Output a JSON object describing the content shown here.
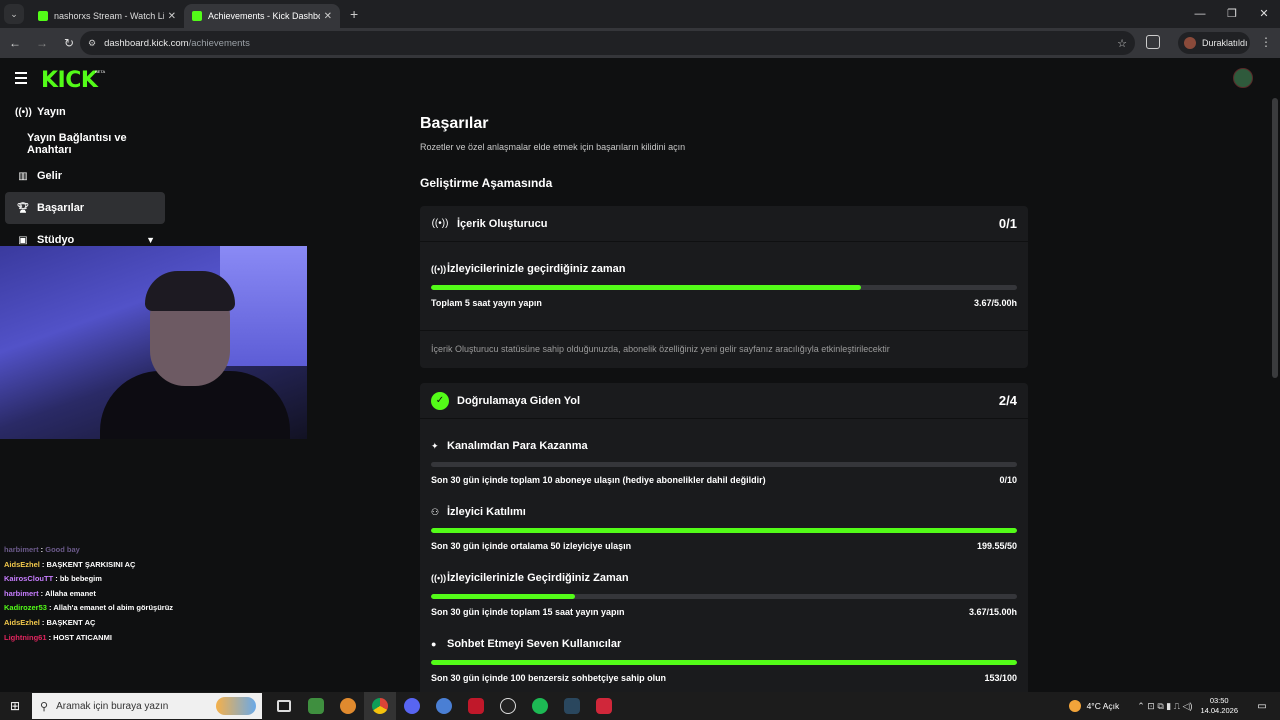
{
  "browser": {
    "tabs": [
      {
        "label": "nashorxs Stream - Watch Live o",
        "active": false
      },
      {
        "label": "Achievements - Kick Dashboard",
        "active": true
      }
    ],
    "url_host": "dashboard.kick.com",
    "url_path": "/achievements",
    "profile_label": "Duraklatıldı",
    "new_tab_glyph": "+",
    "close_glyph": "✕"
  },
  "app": {
    "logo": "KICK",
    "logo_badge": "BETA",
    "accent_color": "#53fc18"
  },
  "sidebar": {
    "items": [
      {
        "label": "Yayın",
        "icon": "broadcast-icon"
      },
      {
        "label": "Yayın Bağlantısı ve Anahtarı",
        "icon": ""
      },
      {
        "label": "Gelir",
        "icon": "chart-icon"
      },
      {
        "label": "Başarılar",
        "icon": "trophy-icon",
        "active": true
      },
      {
        "label": "Stüdyo",
        "icon": "studio-icon"
      }
    ]
  },
  "main": {
    "title": "Başarılar",
    "subtitle": "Rozetler ve özel anlaşmalar elde etmek için başarıların kilidini açın",
    "section_title": "Geliştirme Aşamasında",
    "cards": [
      {
        "title": "İçerik Oluşturucu",
        "progress": "0/1",
        "tasks": [
          {
            "title": "İzleyicilerinizle geçirdiğiniz zaman",
            "requirement": "Toplam 5 saat yayın yapın",
            "value": "3.67/5.00h",
            "fraction": 0.734
          }
        ],
        "note": "İçerik Oluşturucu statüsüne sahip olduğunuzda, abonelik özelliğiniz yeni gelir sayfanız aracılığıyla etkinleştirilecektir"
      },
      {
        "title": "Doğrulamaya Giden Yol",
        "progress": "2/4",
        "tasks": [
          {
            "title": "Kanalımdan Para Kazanma",
            "requirement": "Son 30 gün içinde toplam 10 aboneye ulaşın (hediye abonelikler dahil değildir)",
            "value": "0/10",
            "fraction": 0.0
          },
          {
            "title": "İzleyici Katılımı",
            "requirement": "Son 30 gün içinde ortalama 50 izleyiciye ulaşın",
            "value": "199.55/50",
            "fraction": 1.0
          },
          {
            "title": "İzleyicilerinizle Geçirdiğiniz Zaman",
            "requirement": "Son 30 gün içinde toplam 15 saat yayın yapın",
            "value": "3.67/15.00h",
            "fraction": 0.245
          },
          {
            "title": "Sohbet Etmeyi Seven Kullanıcılar",
            "requirement": "Son 30 gün içinde 100 benzersiz sohbetçiye sahip olun",
            "value": "153/100",
            "fraction": 1.0
          }
        ]
      }
    ]
  },
  "chat": [
    {
      "user": "harbimert",
      "text": "Good bay",
      "color": "#6b5a8a"
    },
    {
      "user": "AidsEzhel",
      "text": "BAŞKENT ŞARKISINI AÇ",
      "color": "#f2c94c"
    },
    {
      "user": "KairosClouTT",
      "text": "bb bebegim",
      "color": "#c77dff"
    },
    {
      "user": "harbimert",
      "text": "Allaha emanet",
      "color": "#c77dff"
    },
    {
      "user": "Kadirozer53",
      "text": "Allah'a emanet ol abim görüşürüz",
      "color": "#53fc18"
    },
    {
      "user": "AidsEzhel",
      "text": "BAŞKENT AÇ",
      "color": "#f2c94c"
    },
    {
      "user": "Lightning61",
      "text": "HOST ATICANMI",
      "color": "#e0245e"
    }
  ],
  "taskbar": {
    "search_placeholder": "Aramak için buraya yazın",
    "weather": "4°C  Açık",
    "time": "03:50",
    "date": "14.04.2026"
  }
}
